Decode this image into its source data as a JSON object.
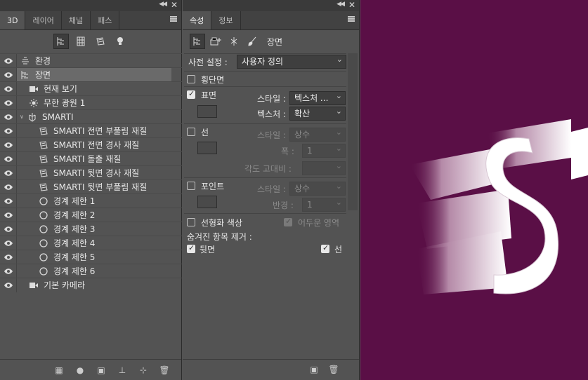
{
  "panel3d": {
    "tabs": [
      "3D",
      "레이어",
      "채널",
      "패스"
    ],
    "layers": [
      {
        "label": "환경",
        "icon": "environment-icon",
        "indent": 0
      },
      {
        "label": "장면",
        "icon": "scene-icon",
        "indent": 0,
        "selected": true
      },
      {
        "label": "현재 보기",
        "icon": "camera-icon",
        "indent": 1
      },
      {
        "label": "무한 광원 1",
        "icon": "infinite-light-icon",
        "indent": 1
      },
      {
        "label": "SMARTI",
        "icon": "mesh-icon",
        "indent": 0,
        "twisty": "∨"
      },
      {
        "label": "SMARTI 전면 부풀림 재질",
        "icon": "material-icon",
        "indent": 2
      },
      {
        "label": "SMARTI 전면 경사 재질",
        "icon": "material-icon",
        "indent": 2
      },
      {
        "label": "SMARTI 돌출 재질",
        "icon": "material-icon",
        "indent": 2
      },
      {
        "label": "SMARTI 뒷면 경사 재질",
        "icon": "material-icon",
        "indent": 2
      },
      {
        "label": "SMARTI 뒷면 부풀림 재질",
        "icon": "material-icon",
        "indent": 2
      },
      {
        "label": "경계 제한 1",
        "icon": "boundary-icon",
        "indent": 2
      },
      {
        "label": "경계 제한 2",
        "icon": "boundary-icon",
        "indent": 2
      },
      {
        "label": "경계 제한 3",
        "icon": "boundary-icon",
        "indent": 2
      },
      {
        "label": "경계 제한 4",
        "icon": "boundary-icon",
        "indent": 2
      },
      {
        "label": "경계 제한 5",
        "icon": "boundary-icon",
        "indent": 2
      },
      {
        "label": "경계 제한 6",
        "icon": "boundary-icon",
        "indent": 2
      },
      {
        "label": "기본 카메라",
        "icon": "camera-icon",
        "indent": 1
      }
    ]
  },
  "properties": {
    "tabs": [
      "속성",
      "정보"
    ],
    "section_label": "장면",
    "preset_label": "사전 설정 :",
    "preset_value": "사용자 정의",
    "cross_section": "횡단면",
    "surface": "표면",
    "style_label": "스타일 :",
    "surface_style": "텍스처 ...",
    "texture_label": "텍스처 :",
    "texture_value": "확산",
    "line": "선",
    "line_style": "상수",
    "width_label": "폭 :",
    "width_value": "1",
    "angle_label": "각도 고대비 :",
    "point": "포인트",
    "point_style": "상수",
    "radius_label": "반경 :",
    "radius_value": "1",
    "linearize": "선형화 색상",
    "dark_area": "어두운 영역",
    "hidden_remove": "숨겨진 항목 제거 :",
    "backface": "뒷면",
    "lines": "선"
  },
  "canvas": {
    "text": "SM",
    "bg_color": "#5a0f46"
  }
}
